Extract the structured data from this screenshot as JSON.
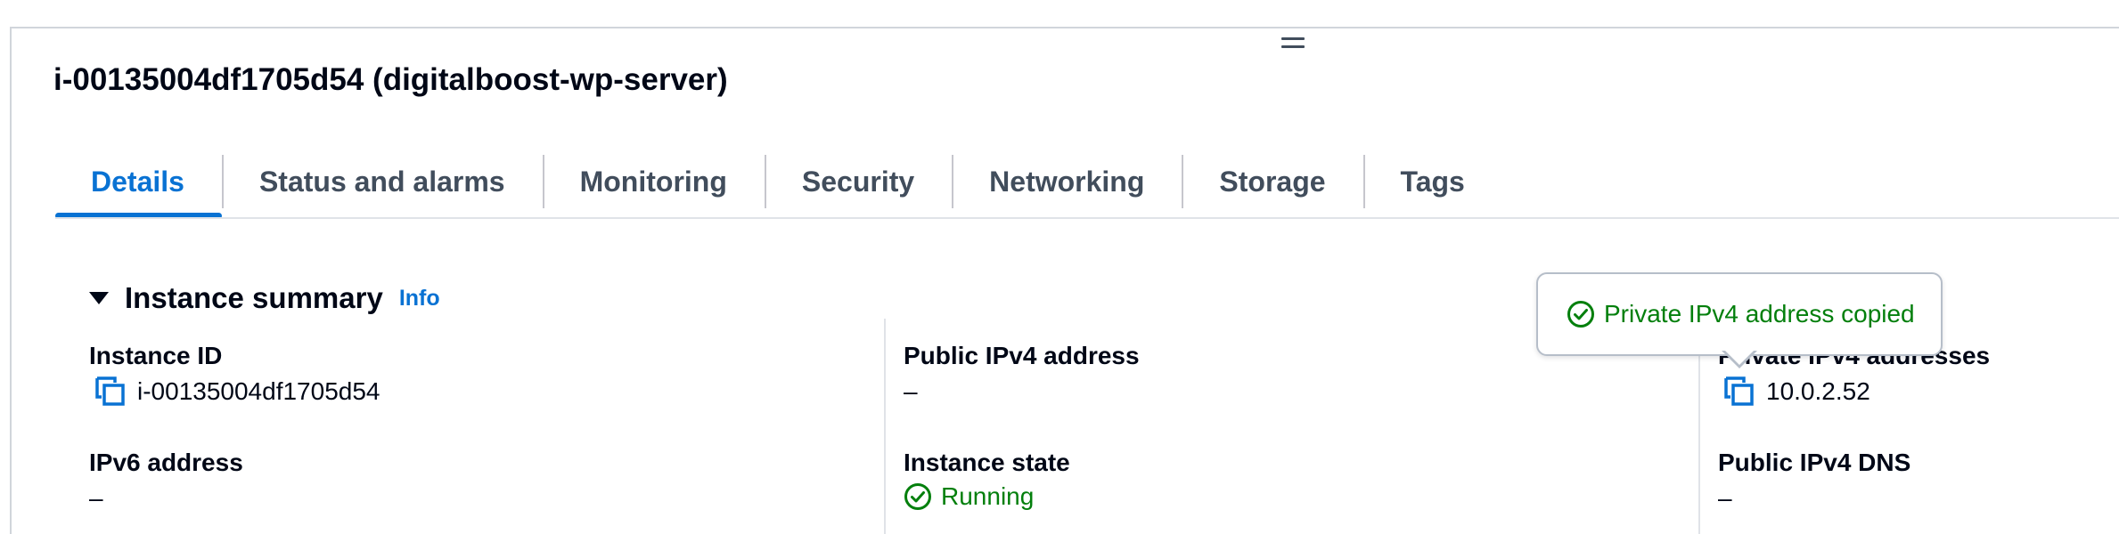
{
  "instance_title": "i-00135004df1705d54 (digitalboost-wp-server)",
  "tabs": [
    {
      "label": "Details",
      "active": true
    },
    {
      "label": "Status and alarms",
      "active": false
    },
    {
      "label": "Monitoring",
      "active": false
    },
    {
      "label": "Security",
      "active": false
    },
    {
      "label": "Networking",
      "active": false
    },
    {
      "label": "Storage",
      "active": false
    },
    {
      "label": "Tags",
      "active": false
    }
  ],
  "summary": {
    "title": "Instance summary",
    "info_link": "Info",
    "instance_id": {
      "label": "Instance ID",
      "value": "i-00135004df1705d54",
      "icon": "copy-icon"
    },
    "public_ipv4": {
      "label": "Public IPv4 address",
      "value": "–"
    },
    "private_ipv4": {
      "label": "Private IPv4 addresses",
      "value": "10.0.2.52",
      "icon": "copy-icon"
    },
    "ipv6": {
      "label": "IPv6 address",
      "value": "–"
    },
    "instance_state": {
      "label": "Instance state",
      "value": "Running",
      "icon": "check-circle-icon"
    },
    "public_ipv4_dns": {
      "label": "Public IPv4 DNS",
      "value": "–"
    }
  },
  "popover": {
    "message": "Private IPv4 address copied",
    "icon": "check-circle-icon"
  },
  "colors": {
    "accent": "#0972d3",
    "success": "#037f0c",
    "text": "#000716",
    "tab_inactive": "#414d5c"
  }
}
